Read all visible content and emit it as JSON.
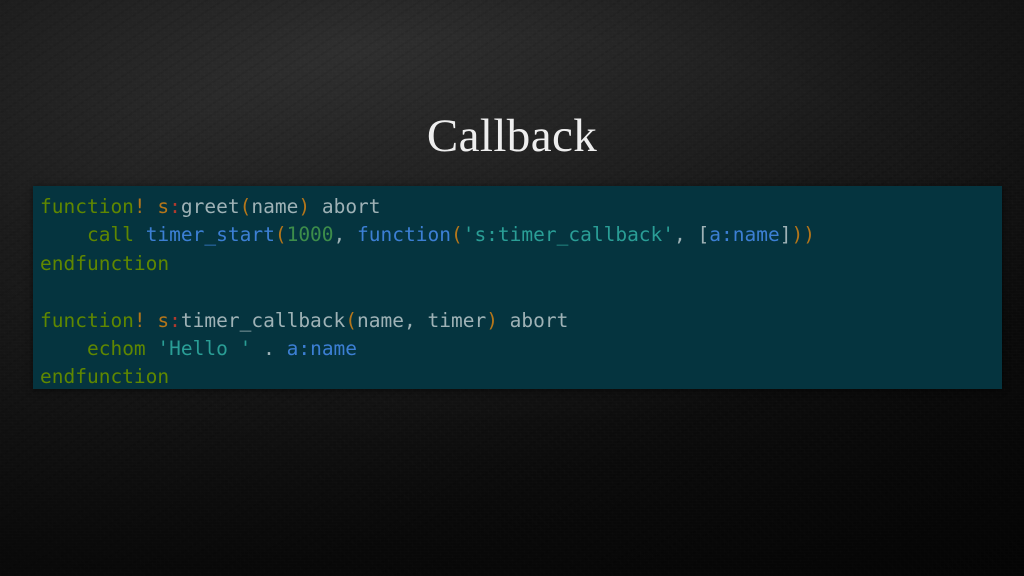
{
  "slide": {
    "title": "Callback",
    "background_color": "#141414",
    "title_color": "#eeeeee"
  },
  "code_block": {
    "language": "vim",
    "background_color": "#05343f",
    "palette": {
      "keyword": "#5f8700",
      "bang": "#b5761a",
      "scope": "#b5761a",
      "colon": "#b03a2e",
      "plain": "#9fb2b6",
      "paren": "#b5761a",
      "function": "#3c7fd4",
      "number": "#3d8d4a",
      "string": "#2a9e96",
      "variable": "#3c7fd4",
      "bracket": "#9fb2b6"
    },
    "plain_text": [
      "function! s:greet(name) abort",
      "    call timer_start(1000, function('s:timer_callback', [a:name]))",
      "endfunction",
      "",
      "function! s:timer_callback(name, timer) abort",
      "    echom 'Hello ' . a:name",
      "endfunction"
    ],
    "lines": [
      {
        "index": 0,
        "tokens": [
          {
            "t": "function",
            "c": "keyword"
          },
          {
            "t": "!",
            "c": "bang"
          },
          {
            "t": " ",
            "c": "plain"
          },
          {
            "t": "s",
            "c": "scope"
          },
          {
            "t": ":",
            "c": "colon"
          },
          {
            "t": "greet",
            "c": "plain"
          },
          {
            "t": "(",
            "c": "paren"
          },
          {
            "t": "name",
            "c": "plain"
          },
          {
            "t": ")",
            "c": "paren"
          },
          {
            "t": " abort",
            "c": "plain"
          }
        ]
      },
      {
        "index": 1,
        "tokens": [
          {
            "t": "    ",
            "c": "plain"
          },
          {
            "t": "call",
            "c": "keyword"
          },
          {
            "t": " ",
            "c": "plain"
          },
          {
            "t": "timer_start",
            "c": "function"
          },
          {
            "t": "(",
            "c": "paren"
          },
          {
            "t": "1000",
            "c": "number"
          },
          {
            "t": ", ",
            "c": "plain"
          },
          {
            "t": "function",
            "c": "function"
          },
          {
            "t": "(",
            "c": "paren"
          },
          {
            "t": "'s:timer_callback'",
            "c": "string"
          },
          {
            "t": ", ",
            "c": "plain"
          },
          {
            "t": "[",
            "c": "bracket"
          },
          {
            "t": "a:name",
            "c": "variable"
          },
          {
            "t": "]",
            "c": "bracket"
          },
          {
            "t": ")",
            "c": "paren"
          },
          {
            "t": ")",
            "c": "paren"
          }
        ]
      },
      {
        "index": 2,
        "tokens": [
          {
            "t": "endfunction",
            "c": "keyword"
          }
        ]
      },
      {
        "index": 3,
        "tokens": [
          {
            "t": " ",
            "c": "plain"
          }
        ]
      },
      {
        "index": 4,
        "tokens": [
          {
            "t": "function",
            "c": "keyword"
          },
          {
            "t": "!",
            "c": "bang"
          },
          {
            "t": " ",
            "c": "plain"
          },
          {
            "t": "s",
            "c": "scope"
          },
          {
            "t": ":",
            "c": "colon"
          },
          {
            "t": "timer_callback",
            "c": "plain"
          },
          {
            "t": "(",
            "c": "paren"
          },
          {
            "t": "name, timer",
            "c": "plain"
          },
          {
            "t": ")",
            "c": "paren"
          },
          {
            "t": " abort",
            "c": "plain"
          }
        ]
      },
      {
        "index": 5,
        "tokens": [
          {
            "t": "    ",
            "c": "plain"
          },
          {
            "t": "echom",
            "c": "keyword"
          },
          {
            "t": " ",
            "c": "plain"
          },
          {
            "t": "'Hello '",
            "c": "string"
          },
          {
            "t": " ",
            "c": "plain"
          },
          {
            "t": ".",
            "c": "plain"
          },
          {
            "t": " ",
            "c": "plain"
          },
          {
            "t": "a:name",
            "c": "variable"
          }
        ]
      },
      {
        "index": 6,
        "tokens": [
          {
            "t": "endfunction",
            "c": "keyword"
          }
        ]
      }
    ]
  }
}
